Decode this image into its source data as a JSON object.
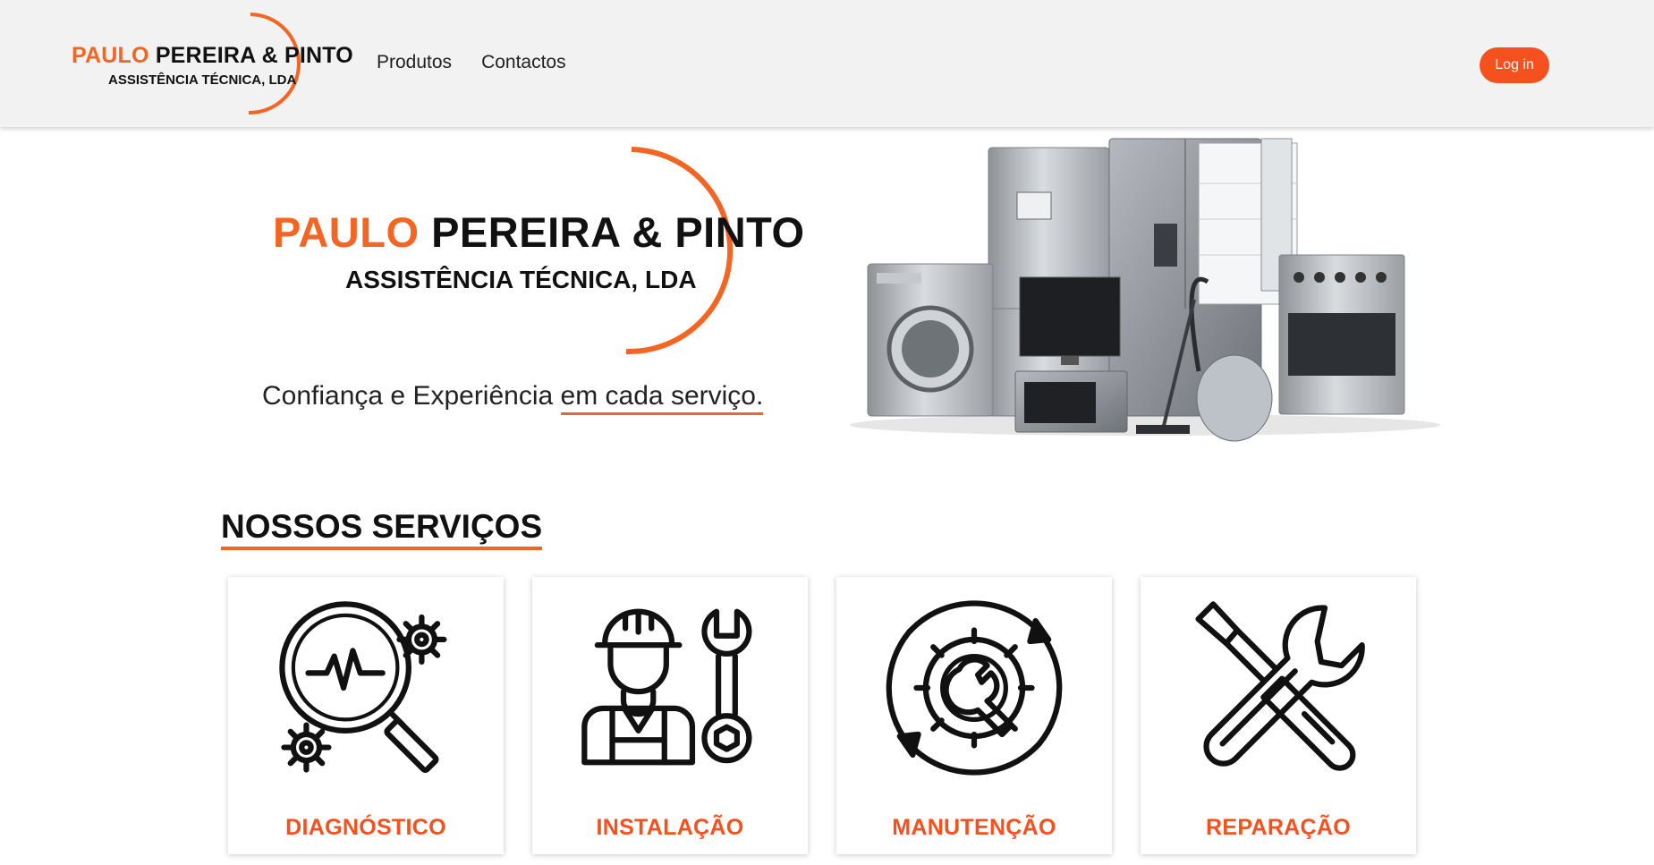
{
  "header": {
    "logo": {
      "name_accent": "PAULO",
      "name_rest": "PEREIRA & PINTO",
      "subtitle": "ASSISTÊNCIA TÉCNICA, LDA"
    },
    "nav": [
      {
        "label": "Produtos"
      },
      {
        "label": "Contactos"
      }
    ],
    "login_label": "Log in"
  },
  "hero": {
    "brand": {
      "name_accent": "PAULO",
      "name_rest": "PEREIRA & PINTO",
      "subtitle": "ASSISTÊNCIA TÉCNICA, LDA"
    },
    "tagline_start": "Confiança e Experiência",
    "tagline_highlight": "em cada serviço."
  },
  "services": {
    "title": "NOSSOS SERVIÇOS",
    "items": [
      {
        "label": "DIAGNÓSTICO",
        "icon": "magnifier-gears-icon"
      },
      {
        "label": "INSTALAÇÃO",
        "icon": "technician-wrench-icon"
      },
      {
        "label": "MANUTENÇÃO",
        "icon": "gear-wrench-cycle-icon"
      },
      {
        "label": "REPARAÇÃO",
        "icon": "crossed-tools-icon"
      }
    ]
  },
  "colors": {
    "accent": "#f26522",
    "button": "#f4511e",
    "header_bg": "#f2f2f2"
  }
}
